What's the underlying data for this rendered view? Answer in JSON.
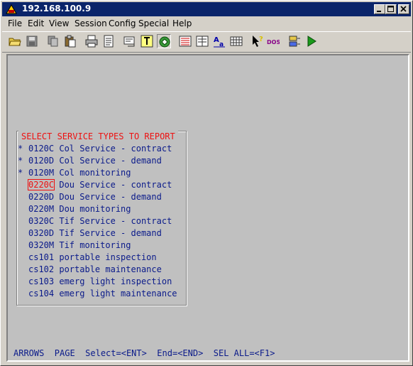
{
  "window": {
    "title": "192.168.100.9"
  },
  "menu": [
    "File",
    "Edit",
    "View",
    "Session",
    "Config",
    "Special",
    "Help"
  ],
  "toolbar_icons": [
    "open-folder-icon",
    "save-icon",
    "copy-icon",
    "paste-icon",
    "print-icon",
    "print-setup-icon",
    "screen-capture-icon",
    "text-capture-icon",
    "connect-icon",
    "keyboard-map-icon",
    "receive-icon",
    "font-icon",
    "grid-icon",
    "pointer-help-icon",
    "dos-icon",
    "macro-icon",
    "run-icon"
  ],
  "dialog": {
    "title": "SELECT SERVICE TYPES TO REPORT",
    "items": [
      {
        "marker": "*",
        "code": "0120C",
        "desc": "Col Service - contract"
      },
      {
        "marker": "*",
        "code": "0120D",
        "desc": "Col Service - demand"
      },
      {
        "marker": "*",
        "code": "0120M",
        "desc": "Col monitoring"
      },
      {
        "marker": "",
        "code": "0220C",
        "desc": "Dou Service - contract"
      },
      {
        "marker": "",
        "code": "0220D",
        "desc": "Dou Service - demand"
      },
      {
        "marker": "",
        "code": "0220M",
        "desc": "Dou monitoring"
      },
      {
        "marker": "",
        "code": "0320C",
        "desc": "Tif Service - contract"
      },
      {
        "marker": "",
        "code": "0320D",
        "desc": "Tif Service - demand"
      },
      {
        "marker": "",
        "code": "0320M",
        "desc": "Tif monitoring"
      },
      {
        "marker": "",
        "code": "cs101",
        "desc": "portable inspection"
      },
      {
        "marker": "",
        "code": "cs102",
        "desc": "portable maintenance"
      },
      {
        "marker": "",
        "code": "cs103",
        "desc": "emerg light inspection"
      },
      {
        "marker": "",
        "code": "cs104",
        "desc": "emerg light maintenance"
      }
    ],
    "cursor_index": 3
  },
  "status_line": "ARROWS  PAGE  Select=<ENT>  End=<END>  SEL ALL=<F1>",
  "colors": {
    "titlebar": "#0a246a",
    "terminal_bg": "#c0c0c0",
    "text_blue": "#0a1a8a",
    "highlight_red": "#ee1111"
  }
}
